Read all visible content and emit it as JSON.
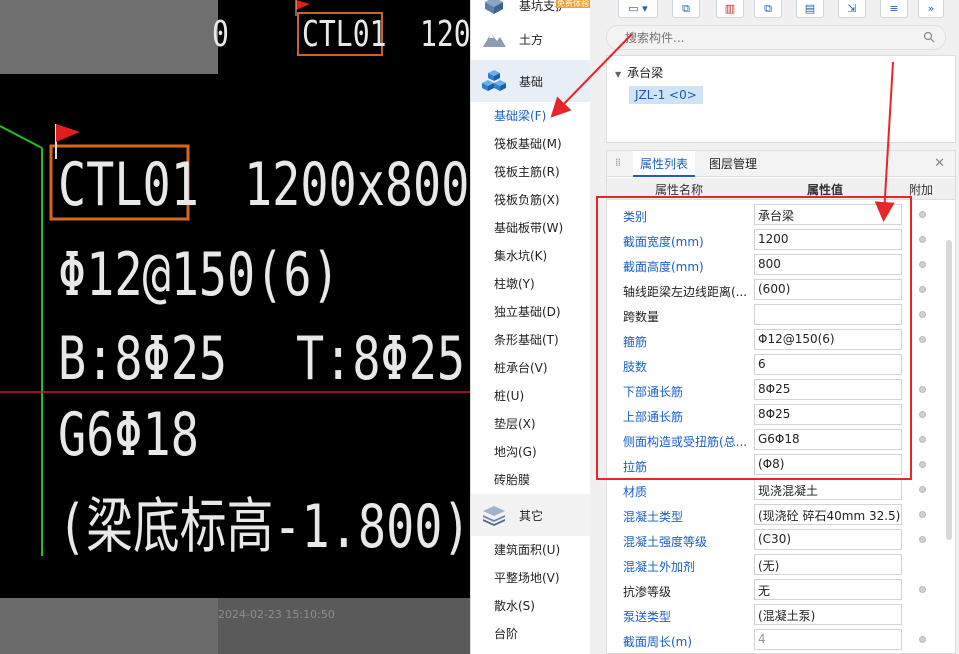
{
  "cad": {
    "top_label_left": "0",
    "top_label": "CTL01",
    "top_label_right": "120",
    "line1_name": "CTL01",
    "line1_size": "1200x800",
    "line2": "Φ12@150(6)",
    "line3_left": "B:8Φ25",
    "line3_right": "T:8Φ25",
    "line4": "G6Φ18",
    "line5": "(梁底标高-1.800)"
  },
  "background": {
    "date": "2024-02-23 15:10:50"
  },
  "sidebar": {
    "groups": [
      {
        "label": "基坑支护",
        "icon": "cube-icon"
      },
      {
        "label": "土方",
        "icon": "mountain-icon"
      },
      {
        "label": "基础",
        "icon": "cubes-icon"
      }
    ],
    "items": [
      "基础梁(F)",
      "筏板基础(M)",
      "筏板主筋(R)",
      "筏板负筋(X)",
      "基础板带(W)",
      "集水坑(K)",
      "柱墩(Y)",
      "独立基础(D)",
      "条形基础(T)",
      "桩承台(V)",
      "桩(U)",
      "垫层(X)",
      "地沟(G)",
      "砖胎膜"
    ],
    "other_group": {
      "label": "其它",
      "icon": "layers-icon"
    },
    "other_items": [
      "建筑面积(U)",
      "平整场地(V)",
      "散水(S)",
      "台阶"
    ],
    "badge": "免费体验"
  },
  "search": {
    "placeholder": "搜索构件..."
  },
  "tree": {
    "root": "承台梁",
    "node": "JZL-1 <0>"
  },
  "props": {
    "tab_active": "属性列表",
    "tab_other": "图层管理",
    "col_name": "属性名称",
    "col_value": "属性值",
    "col_extra": "附加",
    "rows": [
      {
        "name": "类别",
        "value": "承台梁",
        "blue": true,
        "dot": true
      },
      {
        "name": "截面宽度(mm)",
        "value": "1200",
        "blue": true,
        "dot": true
      },
      {
        "name": "截面高度(mm)",
        "value": "800",
        "blue": true,
        "dot": true
      },
      {
        "name": "轴线距梁左边线距离(...",
        "value": "(600)",
        "blue": false,
        "dot": true
      },
      {
        "name": "跨数量",
        "value": "",
        "blue": false,
        "dot": true
      },
      {
        "name": "箍筋",
        "value": "Φ12@150(6)",
        "blue": true,
        "dot": true
      },
      {
        "name": "肢数",
        "value": "6",
        "blue": true,
        "dot": false
      },
      {
        "name": "下部通长筋",
        "value": "8Φ25",
        "blue": true,
        "dot": true
      },
      {
        "name": "上部通长筋",
        "value": "8Φ25",
        "blue": true,
        "dot": true
      },
      {
        "name": "侧面构造或受扭筋(总...",
        "value": "G6Φ18",
        "blue": true,
        "dot": true
      },
      {
        "name": "拉筋",
        "value": "(Φ8)",
        "blue": true,
        "dot": true
      },
      {
        "name": "材质",
        "value": "现浇混凝土",
        "blue": true,
        "dot": true
      },
      {
        "name": "混凝土类型",
        "value": "(现浇砼 碎石40mm 32.5)",
        "blue": true,
        "dot": true
      },
      {
        "name": "混凝土强度等级",
        "value": "(C30)",
        "blue": true,
        "dot": true
      },
      {
        "name": "混凝土外加剂",
        "value": "(无)",
        "blue": true,
        "dot": false
      },
      {
        "name": "抗渗等级",
        "value": "无",
        "blue": false,
        "dot": true
      },
      {
        "name": "泵送类型",
        "value": "(混凝土泵)",
        "blue": true,
        "dot": false
      },
      {
        "name": "截面周长(m)",
        "value": "4",
        "blue": true,
        "dot": true,
        "gray": true
      }
    ]
  }
}
